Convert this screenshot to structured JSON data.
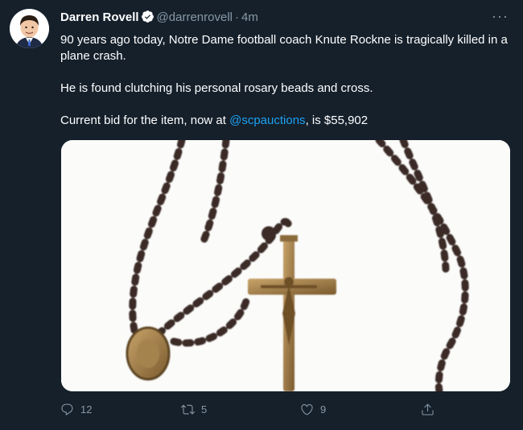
{
  "tweet": {
    "author_name": "Darren Rovell",
    "handle": "@darrenrovell",
    "separator": "·",
    "time": "4m",
    "more": "···",
    "line1": "90 years ago today, Notre Dame football coach Knute Rockne  is tragically killed in a plane crash.",
    "line2": "He is found clutching his personal rosary beads and cross.",
    "line3_prefix": "Current bid for the item, now at ",
    "line3_mention": "@scpauctions",
    "line3_suffix": ", is $55,902"
  },
  "actions": {
    "reply_count": "12",
    "retweet_count": "5",
    "like_count": "9"
  },
  "colors": {
    "background": "#15202b",
    "text": "#ffffff",
    "secondary": "#8899a6",
    "link": "#1da1f2"
  },
  "icons": [
    "verified-badge-icon",
    "more-icon",
    "reply-icon",
    "retweet-icon",
    "like-icon",
    "share-icon"
  ]
}
